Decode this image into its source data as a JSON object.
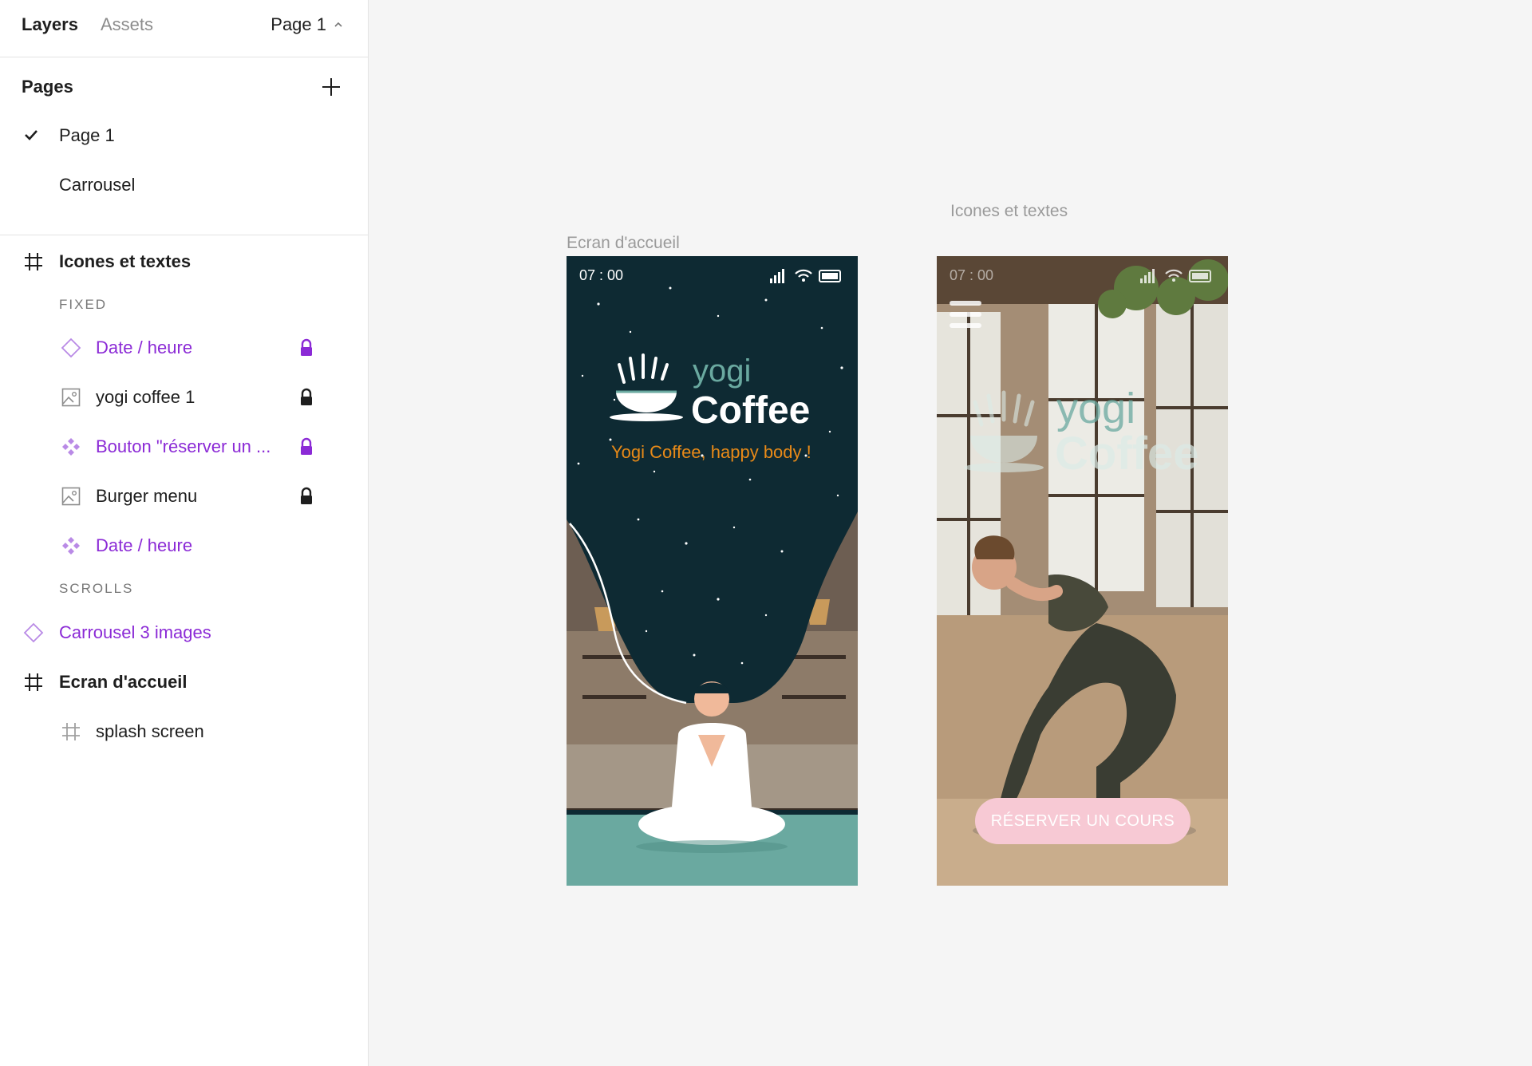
{
  "sidebar": {
    "tabs": {
      "layers": "Layers",
      "assets": "Assets"
    },
    "page_selector": "Page 1",
    "pages": {
      "title": "Pages",
      "items": [
        {
          "label": "Page 1",
          "selected": true
        },
        {
          "label": "Carrousel",
          "selected": false
        }
      ]
    },
    "layers": {
      "frame_icones": "Icones et textes",
      "fixed_label": "FIXED",
      "fixed_items": [
        {
          "label": "Date / heure",
          "icon": "component-instance-icon",
          "locked": true,
          "color": "#8b2ad6"
        },
        {
          "label": "yogi coffee 1",
          "icon": "image-icon",
          "locked": true,
          "color": "#1e1e1e"
        },
        {
          "label": "Bouton \"réserver un ...",
          "icon": "component-icon",
          "locked": true,
          "color": "#8b2ad6"
        },
        {
          "label": "Burger menu",
          "icon": "image-icon",
          "locked": true,
          "color": "#1e1e1e"
        },
        {
          "label": "Date / heure",
          "icon": "component-icon",
          "locked": false,
          "color": "#8b2ad6"
        }
      ],
      "scrolls_label": "SCROLLS",
      "scroll_item": "Carrousel 3 images",
      "frame_ecran": "Ecran d'accueil",
      "ecran_child": "splash screen"
    }
  },
  "canvas": {
    "frame1_label": "Ecran d'accueil",
    "frame2_label": "Icones et textes",
    "phone1": {
      "time": "07 : 00",
      "logo_top": "yogi",
      "logo_bottom": "Coffee",
      "tagline": "Yogi Coffee, happy body !"
    },
    "phone2": {
      "time": "07 : 00",
      "logo_top": "yogi",
      "logo_bottom": "Coffee",
      "button": "RÉSERVER UN COURS"
    }
  },
  "colors": {
    "accent_purple": "#8b2ad6",
    "splash_bg": "#0e2a33",
    "logo_teal": "#6aa9a0",
    "tagline_orange": "#e88a18",
    "button_pink": "#f7c9d4"
  }
}
